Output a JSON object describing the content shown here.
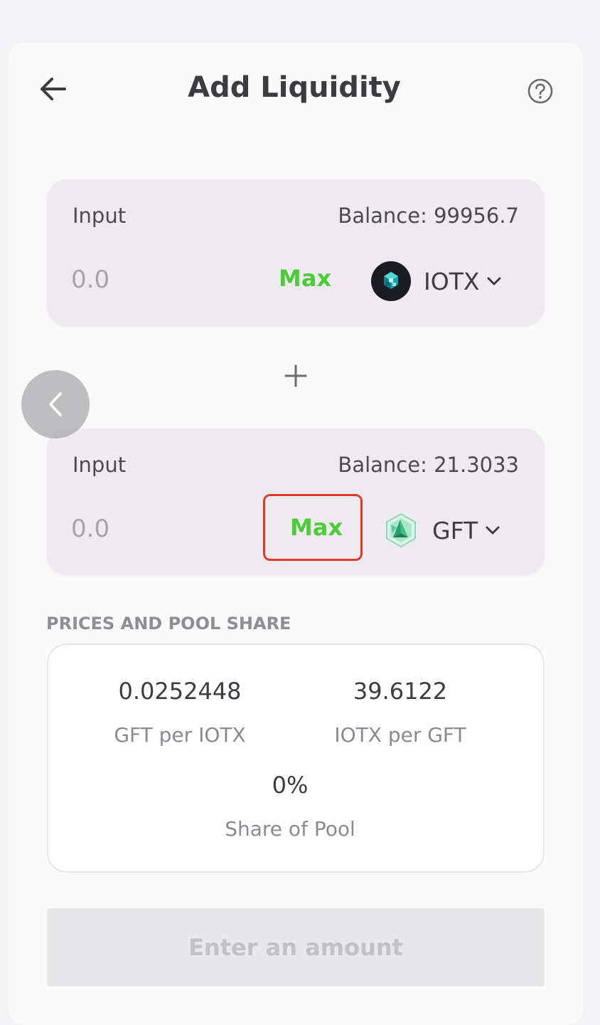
{
  "header": {
    "title": "Add Liquidity",
    "back_icon": "arrow-left-icon",
    "help_icon": "question-circle-icon"
  },
  "token_a": {
    "label": "Input",
    "balance": "Balance: 99956.7",
    "amount_placeholder": "0.0",
    "max_label": "Max",
    "token_symbol": "IOTX",
    "token_icon": "iotx-logo-icon"
  },
  "token_b": {
    "label": "Input",
    "balance": "Balance: 21.3033",
    "amount_placeholder": "0.0",
    "max_label": "Max",
    "token_symbol": "GFT",
    "token_icon": "gft-logo-icon"
  },
  "pool": {
    "heading": "PRICES AND POOL SHARE",
    "rate_a_value": "0.0252448",
    "rate_a_label": "GFT per IOTX",
    "rate_b_value": "39.6122",
    "rate_b_label": "IOTX per GFT",
    "share_value": "0%",
    "share_label": "Share of Pool"
  },
  "submit": {
    "label": "Enter an amount"
  },
  "colors": {
    "accent_green": "#4dcc3a",
    "highlight_red": "#e03a2a",
    "panel_bg": "#eeeaf0"
  }
}
